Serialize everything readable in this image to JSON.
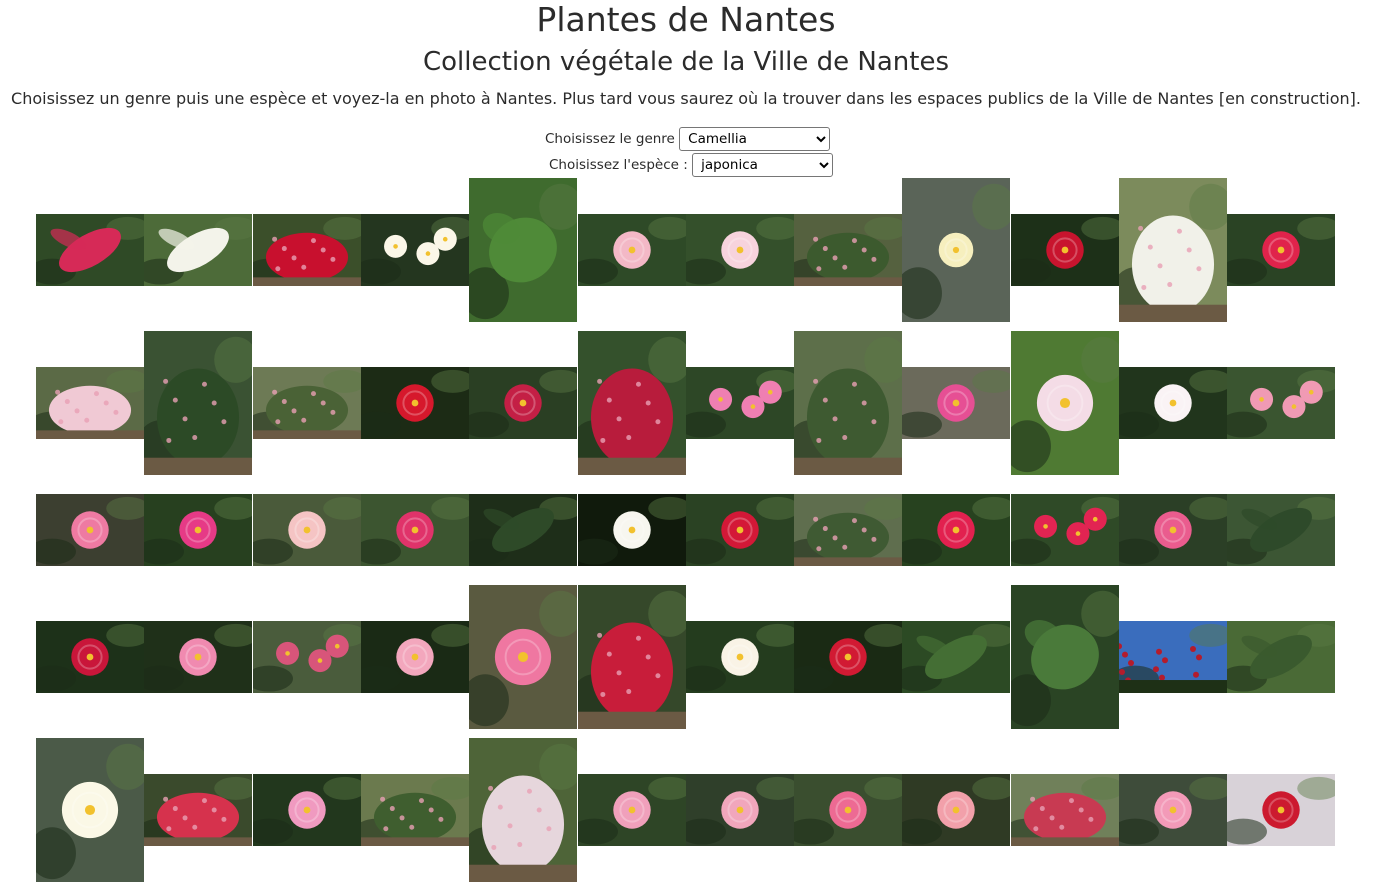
{
  "header": {
    "title": "Plantes de Nantes",
    "subtitle": "Collection végétale de la Ville de Nantes",
    "intro": "Choisissez un genre puis une espèce et voyez-la en photo à Nantes. Plus tard vous saurez où la trouver dans les espaces publics de la Ville de Nantes [en construction]."
  },
  "filters": {
    "genre_label": "Choisissez le genre",
    "genre_value": "Camellia",
    "espece_label": "Choisissez l'espèce :",
    "espece_value": "japonica"
  },
  "gallery": {
    "rows": [
      [
        {
          "o": "l",
          "bg": "#2f4a26",
          "fl": "#d62a57",
          "sub": "leaves"
        },
        {
          "o": "l",
          "bg": "#4d6b39",
          "fl": "#f3f3ea",
          "sub": "leaves"
        },
        {
          "o": "l",
          "bg": "#3b4f2a",
          "fl": "#c8102e",
          "sub": "shrub"
        },
        {
          "o": "l",
          "bg": "#24361f",
          "fl": "#fbf7e8",
          "sub": "flowers"
        },
        {
          "o": "p",
          "bg": "#3f6b2e",
          "fl": "#4f8a38",
          "sub": "leaf"
        },
        {
          "o": "l",
          "bg": "#2e4a27",
          "fl": "#f3b8c6",
          "sub": "flower"
        },
        {
          "o": "l",
          "bg": "#34502b",
          "fl": "#f7d3dd",
          "sub": "flower"
        },
        {
          "o": "l",
          "bg": "#55613f",
          "fl": "#3c5a2e",
          "sub": "shrub"
        },
        {
          "o": "p",
          "bg": "#5a6458",
          "fl": "#f6efbe",
          "sub": "bud"
        },
        {
          "o": "l",
          "bg": "#1d3018",
          "fl": "#c8142e",
          "sub": "flower"
        },
        {
          "o": "p",
          "bg": "#7c8b5c",
          "fl": "#f1f1e9",
          "sub": "shrub"
        },
        {
          "o": "l",
          "bg": "#2a4324",
          "fl": "#e0234b",
          "sub": "flower"
        }
      ],
      [
        {
          "o": "l",
          "bg": "#5b6a46",
          "fl": "#f0c9d4",
          "sub": "shrub"
        },
        {
          "o": "p",
          "bg": "#3a5233",
          "fl": "#2c4a26",
          "sub": "shrub"
        },
        {
          "o": "l",
          "bg": "#6d7a55",
          "fl": "#4a6236",
          "sub": "tree"
        },
        {
          "o": "l",
          "bg": "#1c2b15",
          "fl": "#d6182c",
          "sub": "flower"
        },
        {
          "o": "l",
          "bg": "#2a3f23",
          "fl": "#c41f45",
          "sub": "flower"
        },
        {
          "o": "p",
          "bg": "#34512c",
          "fl": "#b81c3c",
          "sub": "shrub"
        },
        {
          "o": "l",
          "bg": "#2d4726",
          "fl": "#ef7fb2",
          "sub": "flowers"
        },
        {
          "o": "p",
          "bg": "#5d6f4a",
          "fl": "#3e5a31",
          "sub": "tree"
        },
        {
          "o": "l",
          "bg": "#6b6a5b",
          "fl": "#e64f94",
          "sub": "flower"
        },
        {
          "o": "p",
          "bg": "#4f7a33",
          "fl": "#f4dce6",
          "sub": "flower"
        },
        {
          "o": "l",
          "bg": "#21351c",
          "fl": "#faf3f5",
          "sub": "flower"
        },
        {
          "o": "l",
          "bg": "#3a5530",
          "fl": "#f09ab4",
          "sub": "flowers"
        }
      ],
      [
        {
          "o": "l",
          "bg": "#3c3f30",
          "fl": "#ee7aa2",
          "sub": "flower"
        },
        {
          "o": "l",
          "bg": "#27401f",
          "fl": "#e63a86",
          "sub": "flower"
        },
        {
          "o": "l",
          "bg": "#4a5a3a",
          "fl": "#f5c4c4",
          "sub": "flower"
        },
        {
          "o": "l",
          "bg": "#3c5530",
          "fl": "#e0336a",
          "sub": "flower"
        },
        {
          "o": "l",
          "bg": "#1e2e19",
          "fl": "#2e4a28",
          "sub": "leaves"
        },
        {
          "o": "l",
          "bg": "#101a0c",
          "fl": "#f7f6ef",
          "sub": "flower"
        },
        {
          "o": "l",
          "bg": "#2a4223",
          "fl": "#d41837",
          "sub": "flower"
        },
        {
          "o": "l",
          "bg": "#5f6e4e",
          "fl": "#3f5a33",
          "sub": "shrub"
        },
        {
          "o": "l",
          "bg": "#27421f",
          "fl": "#e2214f",
          "sub": "flower"
        },
        {
          "o": "l",
          "bg": "#2f4a27",
          "fl": "#e22452",
          "sub": "flowers"
        },
        {
          "o": "l",
          "bg": "#2b3f26",
          "fl": "#ea5c8e",
          "sub": "flower"
        },
        {
          "o": "l",
          "bg": "#3c5634",
          "fl": "#2e4a2a",
          "sub": "leaves"
        }
      ],
      [
        {
          "o": "l",
          "bg": "#1d3119",
          "fl": "#c9163a",
          "sub": "flower"
        },
        {
          "o": "l",
          "bg": "#1f3019",
          "fl": "#f08ab0",
          "sub": "flower"
        },
        {
          "o": "l",
          "bg": "#4a5c3c",
          "fl": "#d8557a",
          "sub": "flowers"
        },
        {
          "o": "l",
          "bg": "#1a2a15",
          "fl": "#f3a7bd",
          "sub": "flower"
        },
        {
          "o": "p",
          "bg": "#5a5a40",
          "fl": "#ef77a1",
          "sub": "flower"
        },
        {
          "o": "p",
          "bg": "#35482a",
          "fl": "#c81d3a",
          "sub": "tree"
        },
        {
          "o": "l",
          "bg": "#243c1e",
          "fl": "#f9f3e6",
          "sub": "flower"
        },
        {
          "o": "l",
          "bg": "#1a2a14",
          "fl": "#d11a33",
          "sub": "flower"
        },
        {
          "o": "l",
          "bg": "#2c4a24",
          "fl": "#446e34",
          "sub": "leaves"
        },
        {
          "o": "p",
          "bg": "#2a4424",
          "fl": "#4a7a3a",
          "sub": "leaves"
        },
        {
          "o": "l",
          "bg": "#3a6dbd",
          "fl": "#b41c2c",
          "sub": "sky"
        },
        {
          "o": "l",
          "bg": "#4a6a36",
          "fl": "#3a5a2e",
          "sub": "leaves"
        }
      ],
      [
        {
          "o": "p",
          "bg": "#4b5a48",
          "fl": "#fbf8e6",
          "sub": "flower"
        },
        {
          "o": "l",
          "bg": "#3a4a2c",
          "fl": "#d6324d",
          "sub": "shrub"
        },
        {
          "o": "l",
          "bg": "#22371d",
          "fl": "#f09ac0",
          "sub": "flower"
        },
        {
          "o": "l",
          "bg": "#6b7a4e",
          "fl": "#3f5e2f",
          "sub": "shrub"
        },
        {
          "o": "p",
          "bg": "#4e6438",
          "fl": "#e6d6dc",
          "sub": "shrub"
        },
        {
          "o": "l",
          "bg": "#2e4526",
          "fl": "#f0a0bb",
          "sub": "flower"
        },
        {
          "o": "l",
          "bg": "#2f3f2a",
          "fl": "#f1a6bc",
          "sub": "flower"
        },
        {
          "o": "l",
          "bg": "#3a4e2f",
          "fl": "#ed6a93",
          "sub": "flower"
        },
        {
          "o": "l",
          "bg": "#2f3a24",
          "fl": "#f2a0aa",
          "sub": "flower"
        },
        {
          "o": "l",
          "bg": "#70805a",
          "fl": "#c83a52",
          "sub": "shrub"
        },
        {
          "o": "l",
          "bg": "#3e4c3a",
          "fl": "#f39ab8",
          "sub": "flower"
        },
        {
          "o": "l",
          "bg": "#d8d2d8",
          "fl": "#cc1a2f",
          "sub": "flower"
        }
      ]
    ]
  }
}
